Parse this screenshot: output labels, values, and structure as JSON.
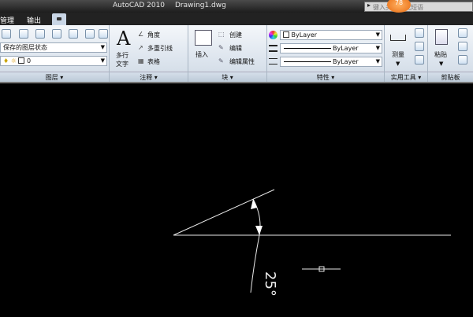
{
  "window": {
    "app_title": "AutoCAD 2010",
    "document_title": "Drawing1.dwg"
  },
  "search": {
    "placeholder": "键入关键字或短语",
    "badge": "78"
  },
  "tabs": [
    {
      "label": "管理",
      "active": false
    },
    {
      "label": "输出",
      "active": false
    },
    {
      "label": "",
      "active": true
    }
  ],
  "layers": {
    "state_label": "保存的图层状态",
    "current_layer": "0",
    "panel_title": "图层"
  },
  "annotation": {
    "text_label": "多行文字",
    "big_a": "A",
    "angle_label": "角度",
    "mleader_label": "多重引线",
    "table_label": "表格",
    "panel_title": "注释"
  },
  "block": {
    "insert_label": "插入",
    "create_label": "创建",
    "edit_label": "编辑",
    "edit_attr_label": "编辑属性",
    "panel_title": "块"
  },
  "properties": {
    "color": "ByLayer",
    "linetype": "ByLayer",
    "lineweight": "ByLayer",
    "panel_title": "特性"
  },
  "utilities": {
    "measure_label": "测量",
    "panel_title": "实用工具"
  },
  "clipboard": {
    "paste_label": "粘贴",
    "panel_title": "剪贴板"
  },
  "drawing": {
    "angle_text": "25°"
  }
}
